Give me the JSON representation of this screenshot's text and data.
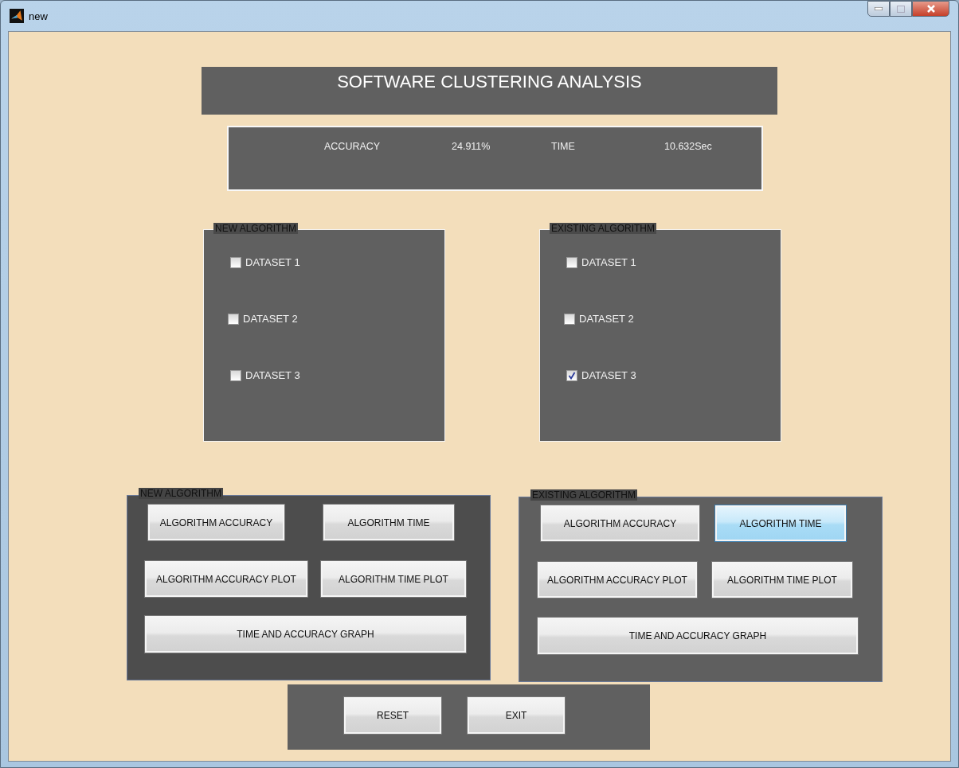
{
  "window": {
    "title": "new"
  },
  "header": {
    "title": "SOFTWARE CLUSTERING ANALYSIS"
  },
  "results": {
    "accuracy_label": "ACCURACY",
    "accuracy_value": "24.911%",
    "time_label": "TIME",
    "time_value": "10.632Sec"
  },
  "dataset_panels": [
    {
      "title": "NEW ALGORITHM",
      "datasets": [
        {
          "label": "DATASET 1",
          "checked": false
        },
        {
          "label": "DATASET 2",
          "checked": false
        },
        {
          "label": "DATASET 3",
          "checked": false
        }
      ]
    },
    {
      "title": "EXISTING ALGORITHM",
      "datasets": [
        {
          "label": "DATASET 1",
          "checked": false
        },
        {
          "label": "DATASET 2",
          "checked": false
        },
        {
          "label": "DATASET 3",
          "checked": true
        }
      ]
    }
  ],
  "action_panels": [
    {
      "title": "NEW ALGORITHM",
      "buttons": [
        {
          "label": "ALGORITHM ACCURACY",
          "selected": false
        },
        {
          "label": "ALGORITHM TIME",
          "selected": false
        },
        {
          "label": "ALGORITHM ACCURACY PLOT",
          "selected": false
        },
        {
          "label": "ALGORITHM TIME PLOT",
          "selected": false
        },
        {
          "label": "TIME AND ACCURACY GRAPH",
          "selected": false
        }
      ]
    },
    {
      "title": "EXISTING ALGORITHM",
      "buttons": [
        {
          "label": "ALGORITHM ACCURACY",
          "selected": false
        },
        {
          "label": "ALGORITHM TIME",
          "selected": true
        },
        {
          "label": "ALGORITHM ACCURACY PLOT",
          "selected": false
        },
        {
          "label": "ALGORITHM TIME PLOT",
          "selected": false
        },
        {
          "label": "TIME AND ACCURACY GRAPH",
          "selected": false
        }
      ]
    }
  ],
  "footer_buttons": [
    {
      "label": "RESET"
    },
    {
      "label": "EXIT"
    }
  ]
}
